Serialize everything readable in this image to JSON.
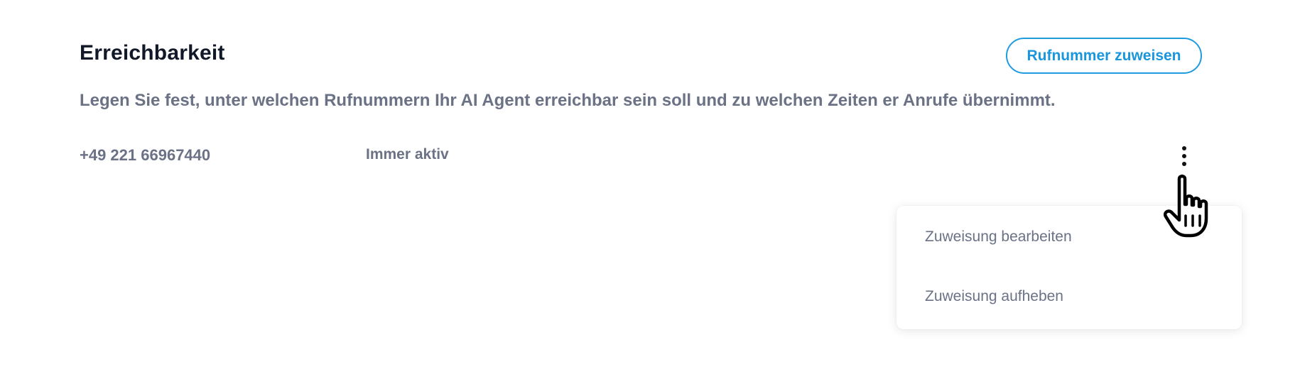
{
  "section": {
    "title": "Erreichbarkeit",
    "assign_button_label": "Rufnummer zuweisen",
    "description": "Legen Sie fest, unter welchen Rufnummern Ihr AI Agent erreichbar sein soll und zu welchen Zeiten er Anrufe übernimmt."
  },
  "numbers": [
    {
      "phone": "+49 221 66967440",
      "status": "Immer aktiv",
      "actions_icon": "kebab-vertical-icon"
    }
  ],
  "menu": {
    "items": [
      {
        "label": "Zuweisung bearbeiten"
      },
      {
        "label": "Zuweisung aufheben"
      }
    ]
  },
  "cursor": {
    "icon": "hand-pointer-icon"
  },
  "colors": {
    "accent": "#1f9be0",
    "title": "#111827",
    "text_muted": "#6b7286"
  }
}
